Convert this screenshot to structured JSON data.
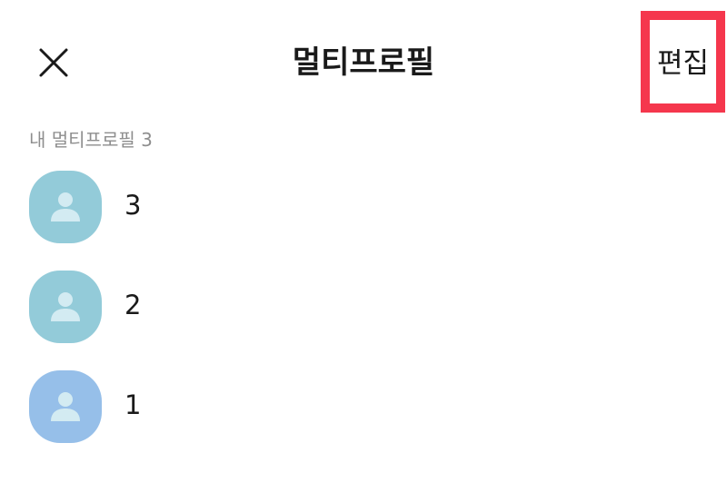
{
  "header": {
    "title": "멀티프로필",
    "edit_label": "편집",
    "close_icon": "close-icon"
  },
  "section": {
    "label": "내 멀티프로필 3"
  },
  "profiles": [
    {
      "label": "3",
      "color": "#93cbd9",
      "icon": "person-icon"
    },
    {
      "label": "2",
      "color": "#93cbd9",
      "icon": "person-icon"
    },
    {
      "label": "1",
      "color": "#96bfe9",
      "icon": "person-icon"
    }
  ],
  "colors": {
    "highlight": "#f5374d",
    "section_label": "#8e8e8e",
    "avatar_icon": "#d3ebf2"
  }
}
